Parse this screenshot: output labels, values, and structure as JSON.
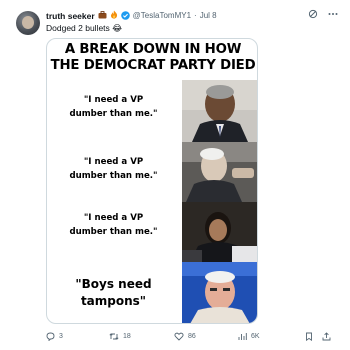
{
  "post": {
    "display_name": "truth seeker",
    "badges": [
      "briefcase-icon",
      "fire-icon",
      "verified-badge-icon"
    ],
    "handle": "@TeslaTomMY1",
    "separator": "·",
    "date": "Jul 8",
    "text": "Dodged 2 bullets",
    "text_emoji": "😂"
  },
  "meme": {
    "title_line1": "A BREAK DOWN IN HOW",
    "title_line2": "THE DEMOCRAT PARTY DIED",
    "panels": [
      {
        "line1": "\"I need a VP",
        "line2": "dumber than me.\""
      },
      {
        "line1": "\"I need a VP",
        "line2": "dumber than me.\""
      },
      {
        "line1": "\"I need a VP",
        "line2": "dumber than me.\""
      },
      {
        "line1": "\"Boys need",
        "line2": "tampons\""
      }
    ]
  },
  "actions": {
    "replies": "3",
    "reposts": "18",
    "likes": "86",
    "views": "6K"
  },
  "colors": {
    "text_primary": "#0f1419",
    "text_secondary": "#536471",
    "verified": "#1d9bf0",
    "border": "#cfd9de"
  }
}
